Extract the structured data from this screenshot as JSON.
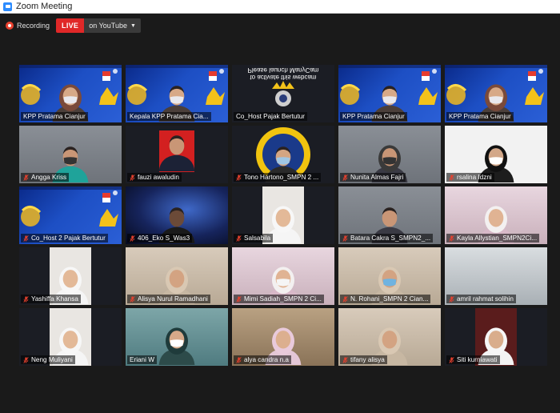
{
  "window": {
    "title": "Zoom Meeting"
  },
  "toolbar": {
    "recording_label": "Recording",
    "live_label": "LIVE",
    "stream_label": "on YouTube"
  },
  "colors": {
    "active_border": "#d9e03b",
    "live": "#e02828",
    "mic_muted": "#e8412e",
    "banner": "#1d4fc4"
  },
  "tiles": [
    {
      "name": "KPP Pratama Cianjur",
      "muted": false,
      "active": true,
      "style": "banner-person"
    },
    {
      "name": "Kepala KPP Pratama Cia...",
      "muted": false,
      "active": false,
      "style": "banner-person"
    },
    {
      "name": "Co_Host Pajak Bertutur",
      "muted": false,
      "active": false,
      "style": "webcam-off",
      "overlay_text": [
        "Please launch ManyCam",
        "to activate this webcam"
      ]
    },
    {
      "name": "KPP Pratama Cianjur",
      "muted": false,
      "active": false,
      "style": "banner-person"
    },
    {
      "name": "KPP Pratama Cianjur",
      "muted": false,
      "active": false,
      "style": "banner-person"
    },
    {
      "name": "Angga Kriss",
      "muted": true,
      "active": false,
      "style": "room"
    },
    {
      "name": "fauzi awaludin",
      "muted": true,
      "active": false,
      "style": "photo"
    },
    {
      "name": "Tono Hartono_SMPN 2 ...",
      "muted": true,
      "active": false,
      "style": "emblem"
    },
    {
      "name": "Nunita Almas Fajri",
      "muted": true,
      "active": false,
      "style": "room"
    },
    {
      "name": "rsalina Idzni",
      "muted": true,
      "active": false,
      "style": "white"
    },
    {
      "name": "Co_Host 2 Pajak Bertutur",
      "muted": true,
      "active": false,
      "style": "banner"
    },
    {
      "name": "406_Eko S_Was3",
      "muted": true,
      "active": false,
      "style": "space"
    },
    {
      "name": "Salsabila",
      "muted": true,
      "active": false,
      "style": "white-small"
    },
    {
      "name": "Batara Cakra S_SMPN2_...",
      "muted": true,
      "active": false,
      "style": "room"
    },
    {
      "name": "Kayla Allystian_SMPN2Ci...",
      "muted": true,
      "active": false,
      "style": "pink"
    },
    {
      "name": "Yashiffa Khansa",
      "muted": true,
      "active": false,
      "style": "white-small"
    },
    {
      "name": "Alisya Nurul Ramadhani",
      "muted": true,
      "active": false,
      "style": "warm"
    },
    {
      "name": "Mimi Sadiah_SMPN 2 Ci...",
      "muted": true,
      "active": false,
      "style": "pink"
    },
    {
      "name": "N. Rohani_SMPN 2 Cian...",
      "muted": true,
      "active": false,
      "style": "warm"
    },
    {
      "name": "amril rahmat solihin",
      "muted": true,
      "active": false,
      "style": "house"
    },
    {
      "name": "Neng Muliyani",
      "muted": true,
      "active": false,
      "style": "white-small"
    },
    {
      "name": "Eriani W",
      "muted": false,
      "active": false,
      "style": "teal"
    },
    {
      "name": "alya candra n.a",
      "muted": true,
      "active": false,
      "style": "wood"
    },
    {
      "name": "tifany alisya",
      "muted": true,
      "active": false,
      "style": "warm"
    },
    {
      "name": "Siti kurniawati",
      "muted": true,
      "active": false,
      "style": "dark-small"
    }
  ]
}
